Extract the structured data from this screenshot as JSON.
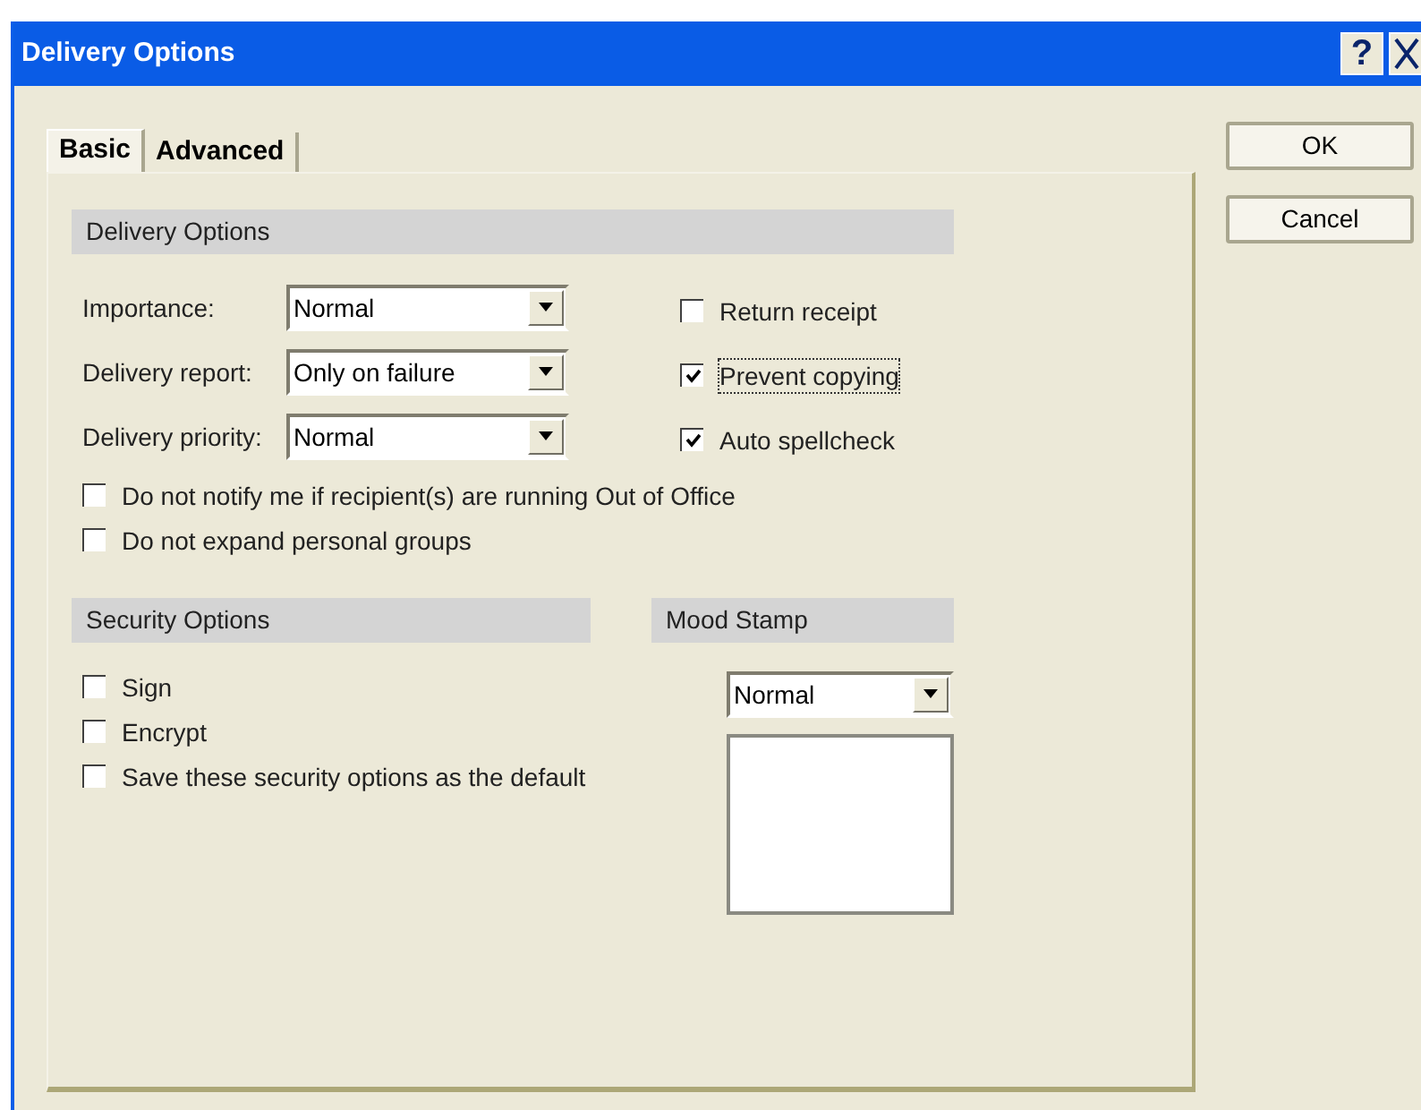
{
  "window": {
    "title": "Delivery Options",
    "help_button": "?"
  },
  "tabs": [
    {
      "label": "Basic",
      "selected": true
    },
    {
      "label": "Advanced",
      "selected": false
    }
  ],
  "delivery_options": {
    "header": "Delivery Options",
    "fields": [
      {
        "label": "Importance:",
        "value": "Normal"
      },
      {
        "label": "Delivery report:",
        "value": "Only on failure"
      },
      {
        "label": "Delivery priority:",
        "value": "Normal"
      }
    ],
    "side_checkboxes": [
      {
        "label": "Return receipt",
        "checked": false,
        "focused": false
      },
      {
        "label": "Prevent copying",
        "checked": true,
        "focused": true
      },
      {
        "label": "Auto spellcheck",
        "checked": true,
        "focused": false
      }
    ],
    "checkboxes": [
      {
        "label": "Do not notify me if recipient(s) are running Out of Office",
        "checked": false,
        "focused": false
      },
      {
        "label": "Do not expand personal groups",
        "checked": false,
        "focused": false
      }
    ]
  },
  "security_options": {
    "header": "Security Options",
    "checkboxes": [
      {
        "label": "Sign",
        "checked": false,
        "focused": false
      },
      {
        "label": "Encrypt",
        "checked": false,
        "focused": false
      },
      {
        "label": "Save these security options as the default",
        "checked": false,
        "focused": false
      }
    ]
  },
  "mood_stamp": {
    "header": "Mood Stamp",
    "value": "Normal"
  },
  "buttons": [
    "OK",
    "Cancel"
  ]
}
